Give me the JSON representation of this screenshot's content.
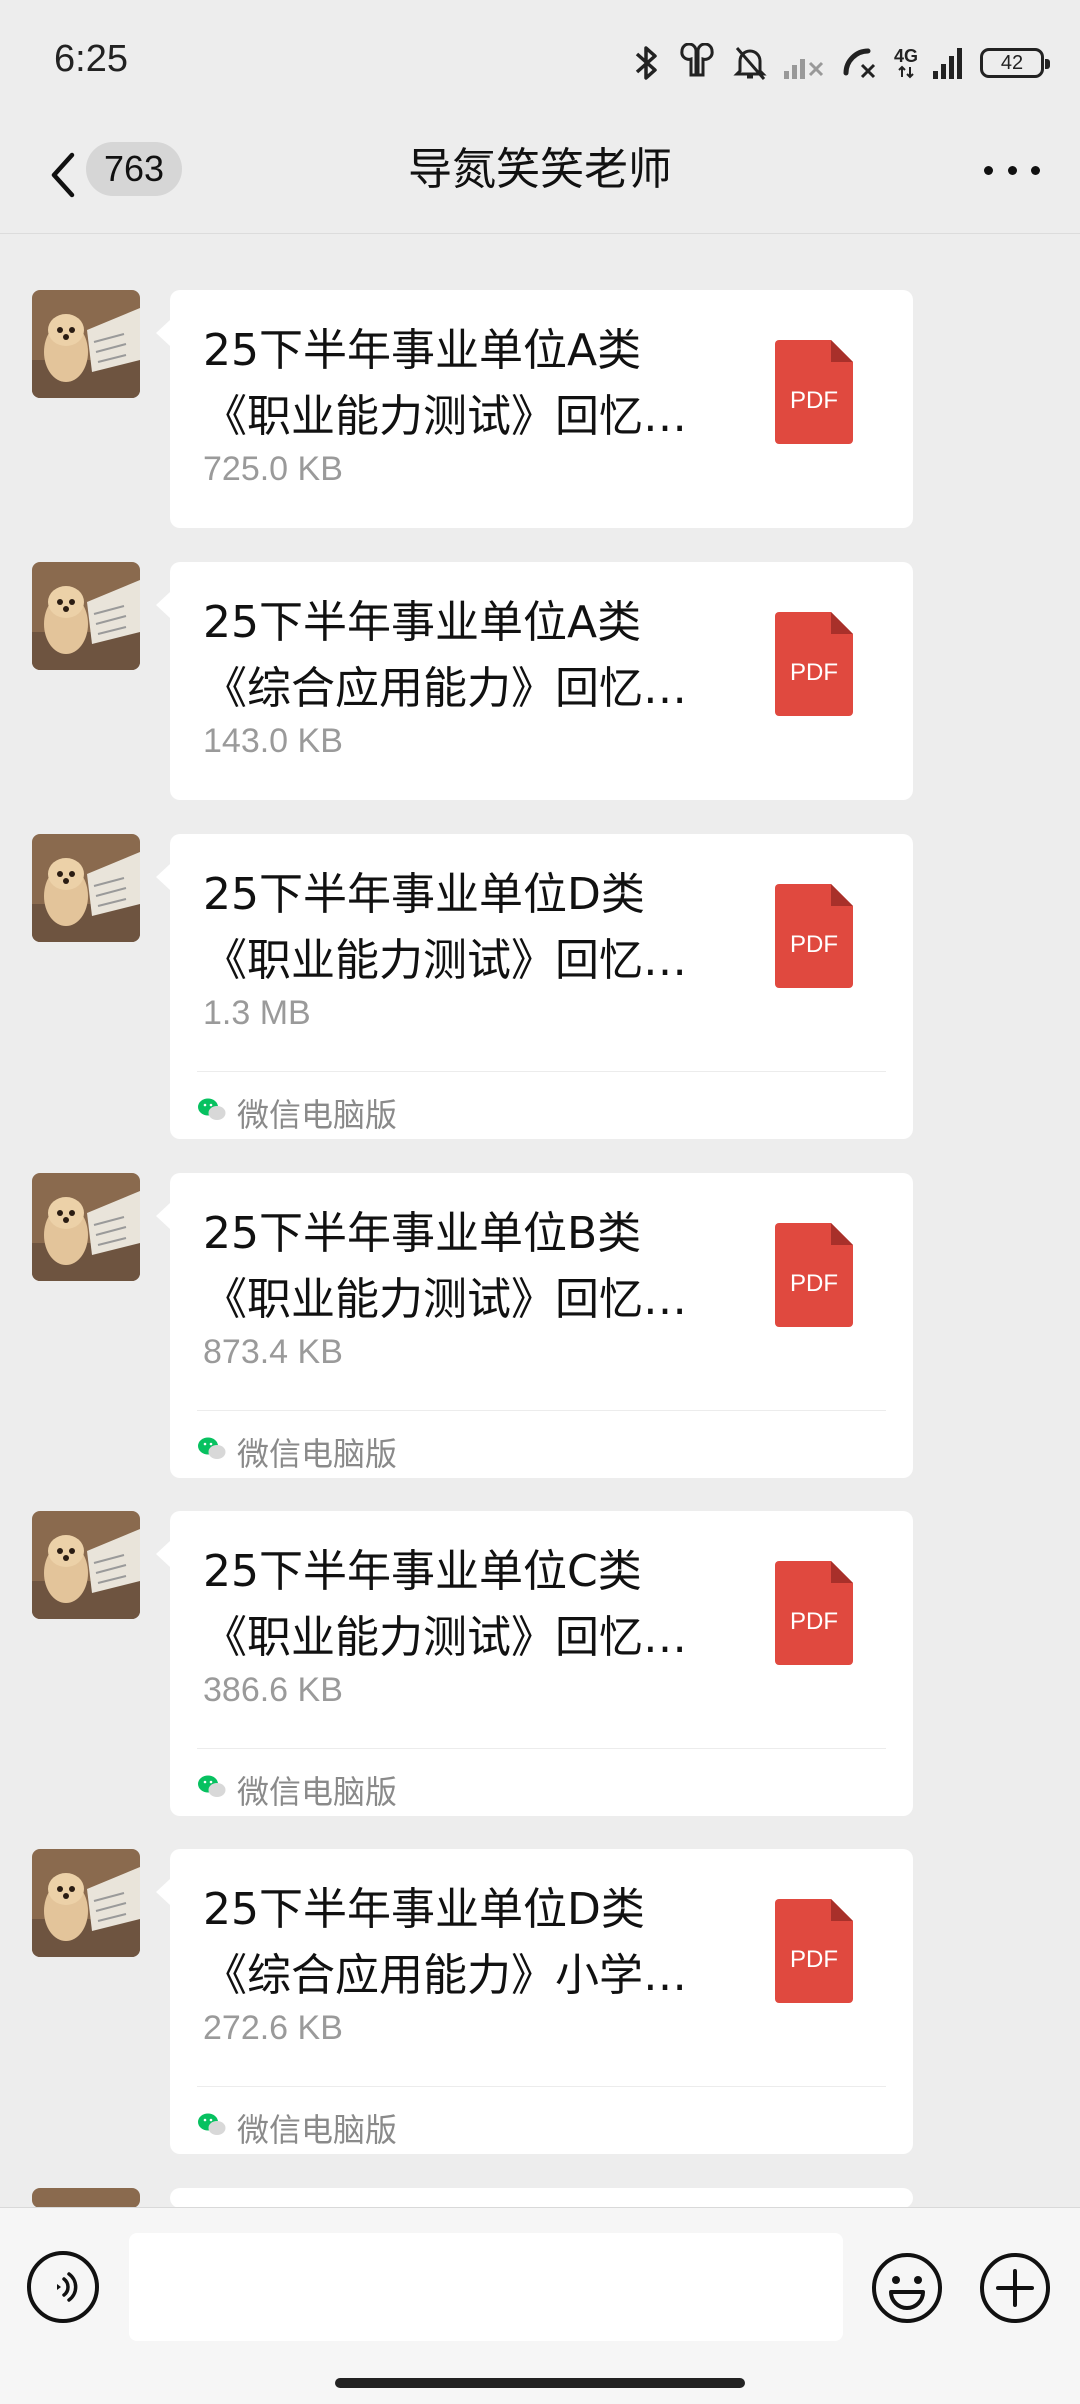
{
  "status_bar": {
    "time": "6:25",
    "network_label": "4G",
    "battery_level": "42",
    "icons": [
      "bluetooth-icon",
      "earbuds-icon",
      "mute-bell-icon",
      "signal-off-icon",
      "call-blocked-icon",
      "signal-icon",
      "battery-icon"
    ]
  },
  "header": {
    "back_icon": "chevron-left-icon",
    "unread_count": "763",
    "title": "导氮笑笑老师",
    "more_icon": "more-dots-icon"
  },
  "messages": [
    {
      "title_line1": "25下半年事业单位A类",
      "title_line2": "《职业能力测试》回忆…",
      "size": "725.0 KB",
      "file_type": "PDF",
      "source": ""
    },
    {
      "title_line1": "25下半年事业单位A类",
      "title_line2": "《综合应用能力》回忆…",
      "size": "143.0 KB",
      "file_type": "PDF",
      "source": ""
    },
    {
      "title_line1": "25下半年事业单位D类",
      "title_line2": "《职业能力测试》回忆…",
      "size": "1.3 MB",
      "file_type": "PDF",
      "source": "微信电脑版"
    },
    {
      "title_line1": "25下半年事业单位B类",
      "title_line2": "《职业能力测试》回忆…",
      "size": "873.4 KB",
      "file_type": "PDF",
      "source": "微信电脑版"
    },
    {
      "title_line1": "25下半年事业单位C类",
      "title_line2": "《职业能力测试》回忆…",
      "size": "386.6 KB",
      "file_type": "PDF",
      "source": "微信电脑版"
    },
    {
      "title_line1": "25下半年事业单位D类",
      "title_line2": "《综合应用能力》小学…",
      "size": "272.6 KB",
      "file_type": "PDF",
      "source": "微信电脑版"
    }
  ],
  "colors": {
    "pdf_red": "#e0493f",
    "background": "#ededed",
    "wechat_green": "#07c160"
  },
  "input_bar": {
    "placeholder": "",
    "icons": [
      "voice-icon",
      "emoji-icon",
      "plus-icon"
    ]
  }
}
